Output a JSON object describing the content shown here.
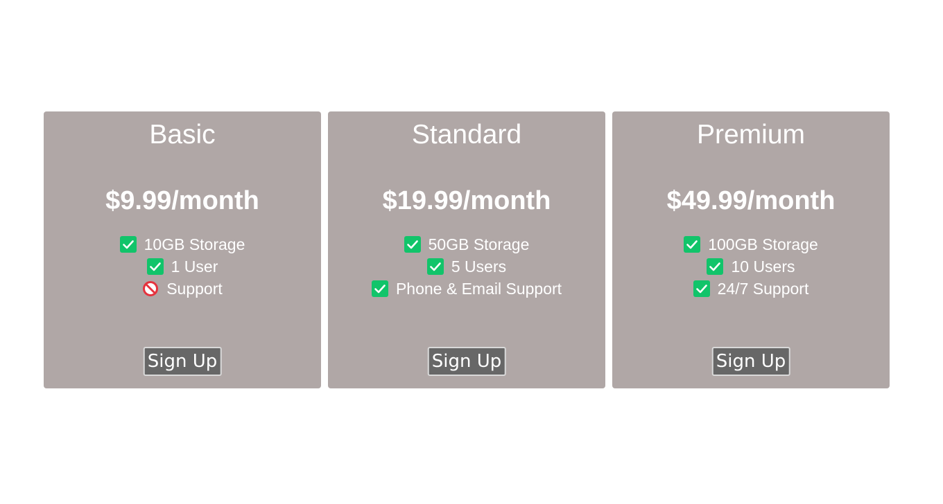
{
  "plans": [
    {
      "name": "Basic",
      "price": "$9.99/month",
      "features": [
        {
          "text": "10GB Storage",
          "icon": "check-icon"
        },
        {
          "text": "1 User",
          "icon": "check-icon"
        },
        {
          "text": "Support",
          "icon": "prohibited-icon"
        }
      ],
      "button_label": "Sign Up"
    },
    {
      "name": "Standard",
      "price": "$19.99/month",
      "features": [
        {
          "text": "50GB Storage",
          "icon": "check-icon"
        },
        {
          "text": "5 Users",
          "icon": "check-icon"
        },
        {
          "text": "Phone & Email Support",
          "icon": "check-icon"
        }
      ],
      "button_label": "Sign Up"
    },
    {
      "name": "Premium",
      "price": "$49.99/month",
      "features": [
        {
          "text": "100GB Storage",
          "icon": "check-icon"
        },
        {
          "text": "10 Users",
          "icon": "check-icon"
        },
        {
          "text": "24/7 Support",
          "icon": "check-icon"
        }
      ],
      "button_label": "Sign Up"
    }
  ],
  "colors": {
    "card_background": "#b0a7a6",
    "check_green": "#11c46a",
    "prohibited_red": "#e5333e",
    "button_background": "#676767"
  }
}
